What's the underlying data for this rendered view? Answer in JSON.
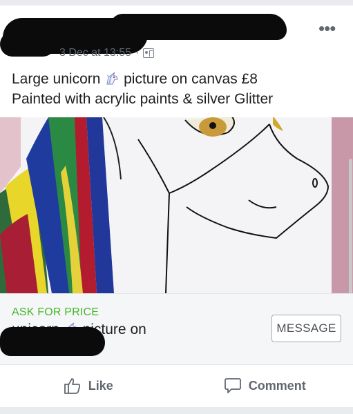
{
  "post": {
    "timestamp": "3 Dec at 13:55",
    "separator": "·",
    "audience_icon": "audience-icon",
    "more_label": "•••",
    "caption_line1_a": "Large unicorn",
    "caption_line1_b": "picture on canvas £8",
    "caption_line2": "Painted with acrylic paints & silver Glitter"
  },
  "listing": {
    "ask_label": "ASK FOR PRICE",
    "title_a": "unicorn",
    "title_b": "picture on",
    "message_label": "MESSAGE"
  },
  "actions": {
    "like_label": "Like",
    "comment_label": "Comment"
  },
  "colors": {
    "green": "#42b72a",
    "muted": "#606770"
  }
}
